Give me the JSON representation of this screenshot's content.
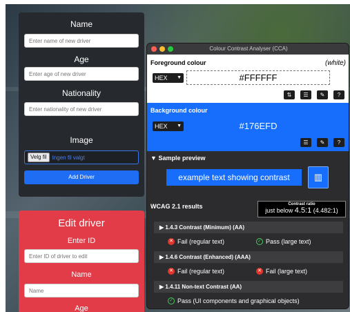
{
  "add_driver": {
    "name_label": "Name",
    "name_placeholder": "Enter name of new driver",
    "age_label": "Age",
    "age_placeholder": "Enter age of new driver",
    "nationality_label": "Nationality",
    "nationality_placeholder": "Enter nationality of new driver",
    "image_label": "Image",
    "file_button": "Velg fil",
    "file_status": "Ingen fil valgt",
    "submit": "Add Driver"
  },
  "edit_driver": {
    "title": "Edit driver",
    "id_label": "Enter ID",
    "id_placeholder": "Enter ID of driver to edit",
    "name_label": "Name",
    "name_placeholder": "Name",
    "age_label": "Age"
  },
  "cca": {
    "window_title": "Colour Contrast Analyser (CCA)",
    "foreground": {
      "title": "Foreground colour",
      "name": "(white)",
      "format": "HEX",
      "value": "#FFFFFF",
      "color": "#FFFFFF"
    },
    "background": {
      "title": "Background colour",
      "format": "HEX",
      "value": "#176EFD",
      "color": "#176EFD"
    },
    "preview": {
      "title": "Sample preview",
      "text": "example text showing contrast"
    },
    "wcag": {
      "title": "WCAG 2.1 results",
      "ratio_label": "Contrast ratio",
      "ratio_prefix": "just below",
      "ratio_value": "4.5:1",
      "ratio_exact": "(4.482:1)",
      "criteria": [
        {
          "title": "1.4.3 Contrast (Minimum) (AA)",
          "result1": "Fail (regular text)",
          "result2": "Pass (large text)"
        },
        {
          "title": "1.4.6 Contrast (Enhanced) (AAA)",
          "result1": "Fail (regular text)",
          "result2": "Fail (large text)"
        },
        {
          "title": "1.4.11 Non-text Contrast (AA)",
          "result1": "Pass (UI components and graphical objects)"
        }
      ]
    },
    "colors": {
      "fail": "#E0352B",
      "pass": "#3FCF5A",
      "accent": "#176EFD"
    }
  }
}
